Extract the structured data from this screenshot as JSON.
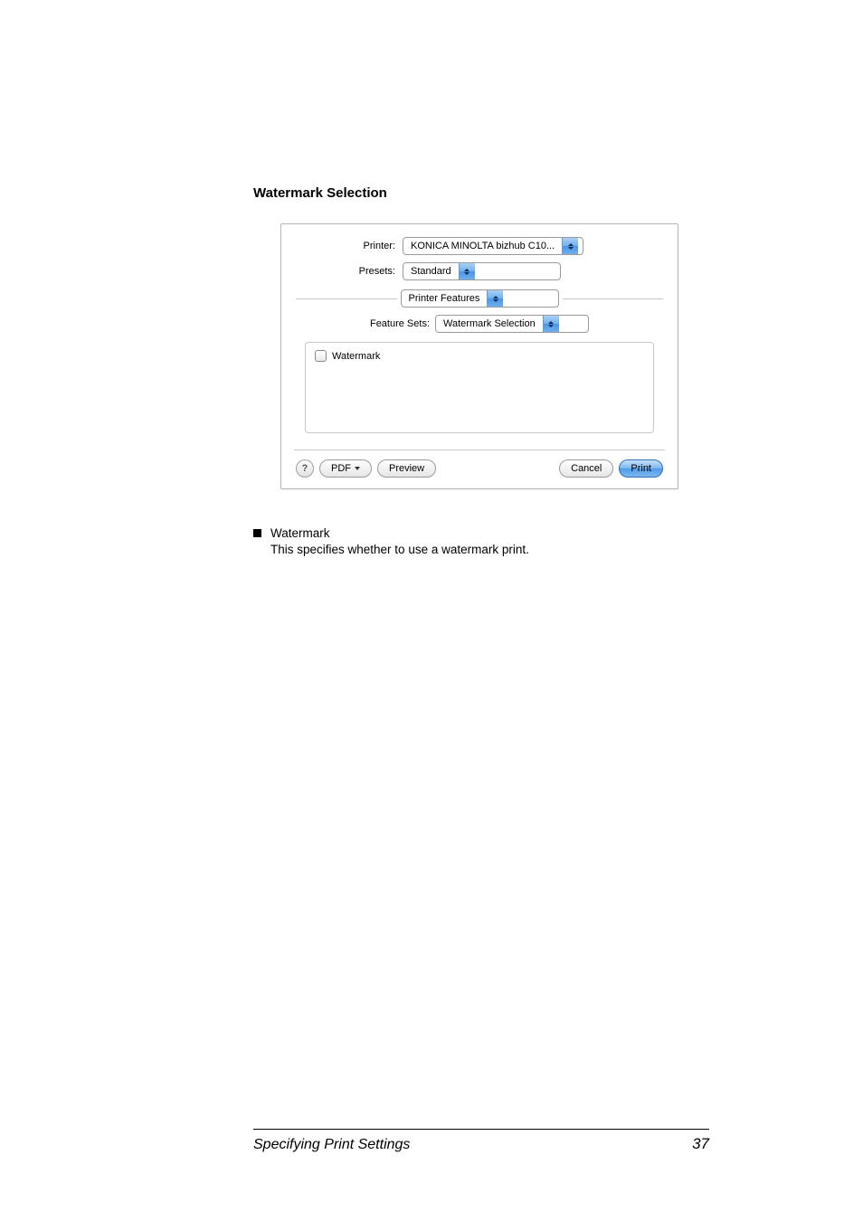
{
  "heading": "Watermark Selection",
  "dialog": {
    "printer_label": "Printer:",
    "printer_value": "KONICA MINOLTA bizhub C10...",
    "presets_label": "Presets:",
    "presets_value": "Standard",
    "section_value": "Printer Features",
    "feature_sets_label": "Feature Sets:",
    "feature_sets_value": "Watermark Selection",
    "watermark_checkbox_label": "Watermark",
    "help_label": "?",
    "pdf_label": "PDF",
    "preview_label": "Preview",
    "cancel_label": "Cancel",
    "print_label": "Print"
  },
  "bullet": {
    "title": "Watermark",
    "body": "This specifies whether to use a watermark print."
  },
  "footer": {
    "left": "Specifying Print Settings",
    "right": "37"
  }
}
